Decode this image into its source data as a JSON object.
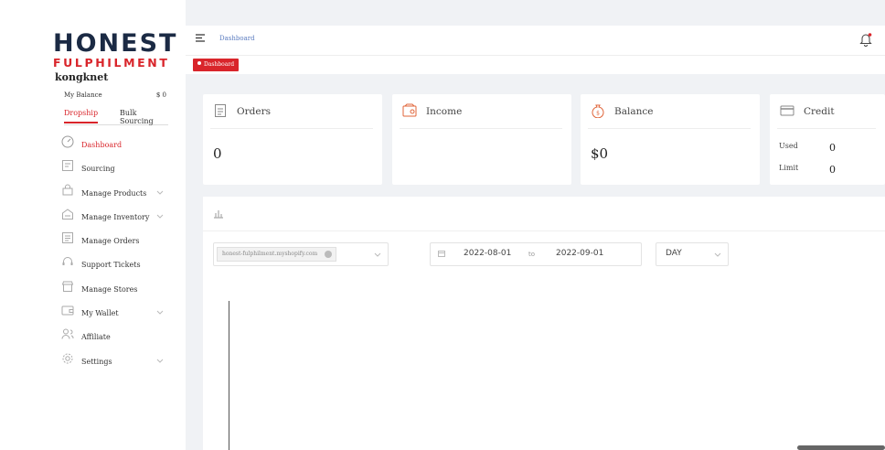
{
  "sidebar": {
    "logo_main": "HONEST",
    "logo_sub": "FULPHILMENT",
    "username": "kongknet",
    "balance_label": "My Balance",
    "balance_value": "$ 0",
    "tabs": [
      "Dropship",
      "Bulk Sourcing"
    ],
    "nav": [
      {
        "label": "Dashboard",
        "icon": "dashboard-icon",
        "active": true,
        "has_chevron": false
      },
      {
        "label": "Sourcing",
        "icon": "sourcing-icon",
        "active": false,
        "has_chevron": false
      },
      {
        "label": "Manage Products",
        "icon": "products-icon",
        "active": false,
        "has_chevron": true
      },
      {
        "label": "Manage Inventory",
        "icon": "inventory-icon",
        "active": false,
        "has_chevron": true
      },
      {
        "label": "Manage Orders",
        "icon": "orders-icon",
        "active": false,
        "has_chevron": false
      },
      {
        "label": "Support Tickets",
        "icon": "support-icon",
        "active": false,
        "has_chevron": false
      },
      {
        "label": "Manage Stores",
        "icon": "store-icon",
        "active": false,
        "has_chevron": false
      },
      {
        "label": "My Wallet",
        "icon": "wallet-icon",
        "active": false,
        "has_chevron": true
      },
      {
        "label": "Affiliate",
        "icon": "affiliate-icon",
        "active": false,
        "has_chevron": false
      },
      {
        "label": "Settings",
        "icon": "settings-icon",
        "active": false,
        "has_chevron": true
      }
    ]
  },
  "header": {
    "breadcrumb": "Dashboard",
    "tag_label": "Dashboard"
  },
  "cards": {
    "orders": {
      "title": "Orders",
      "value": "0"
    },
    "income": {
      "title": "Income",
      "value": ""
    },
    "balance": {
      "title": "Balance",
      "value": "$0"
    },
    "credit": {
      "title": "Credit",
      "used_label": "Used",
      "used_value": "0",
      "limit_label": "Limit",
      "limit_value": "0"
    }
  },
  "filters": {
    "store": "honest-fulphilment.myshopify.com",
    "date_start": "2022-08-01",
    "date_separator": "to",
    "date_end": "2022-09-01",
    "granularity": "DAY"
  },
  "colors": {
    "brand_red": "#d9252b",
    "brand_navy": "#1b2a44",
    "background": "#f0f2f5"
  }
}
